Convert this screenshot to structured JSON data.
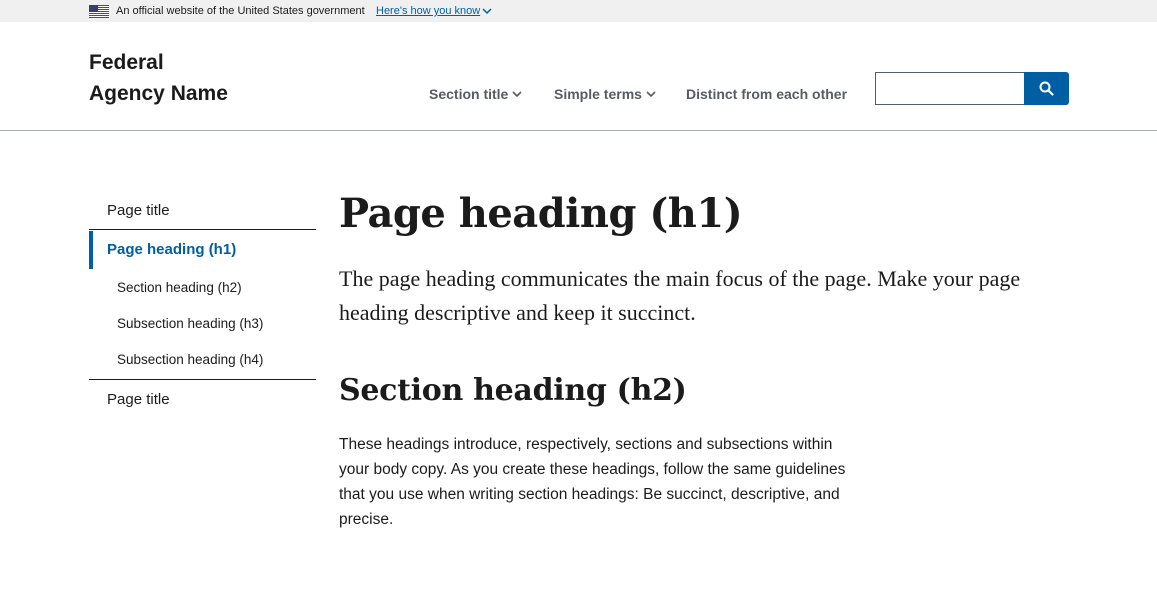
{
  "gov_banner": {
    "flag_icon": "us-flag-icon",
    "text": "An official website of the United States government",
    "link": "Here's how you know",
    "link_icon": "chevron-down-icon"
  },
  "header": {
    "logo_line1": "Federal",
    "logo_line2": "Agency Name",
    "nav": [
      {
        "label": "Section title",
        "icon": "chevron-down-icon"
      },
      {
        "label": "Simple terms",
        "icon": "chevron-down-icon"
      },
      {
        "label": "Distinct from each other"
      }
    ],
    "search": {
      "value": "",
      "button_icon": "search-icon"
    }
  },
  "sidenav": {
    "items": [
      {
        "label": "Page title"
      },
      {
        "label": "Page heading (h1)",
        "current": true
      },
      {
        "label": "Section heading (h2)"
      },
      {
        "label": "Subsection heading (h3)"
      },
      {
        "label": "Subsection heading (h4)"
      },
      {
        "label": "Page title"
      }
    ]
  },
  "main": {
    "h1": "Page heading (h1)",
    "lead": "The page heading communicates the main focus of the page. Make your page heading descriptive and keep it succinct.",
    "h2": "Section heading (h2)",
    "body": "These headings introduce, respectively, sections and subsections within your body copy. As you create these headings, follow the same guidelines that you use when writing section headings: Be succinct, descriptive, and precise."
  },
  "colors": {
    "primary": "#005ea2",
    "banner_bg": "#f0f0f0",
    "text": "#1b1b1b",
    "nav_text": "#565c65"
  }
}
